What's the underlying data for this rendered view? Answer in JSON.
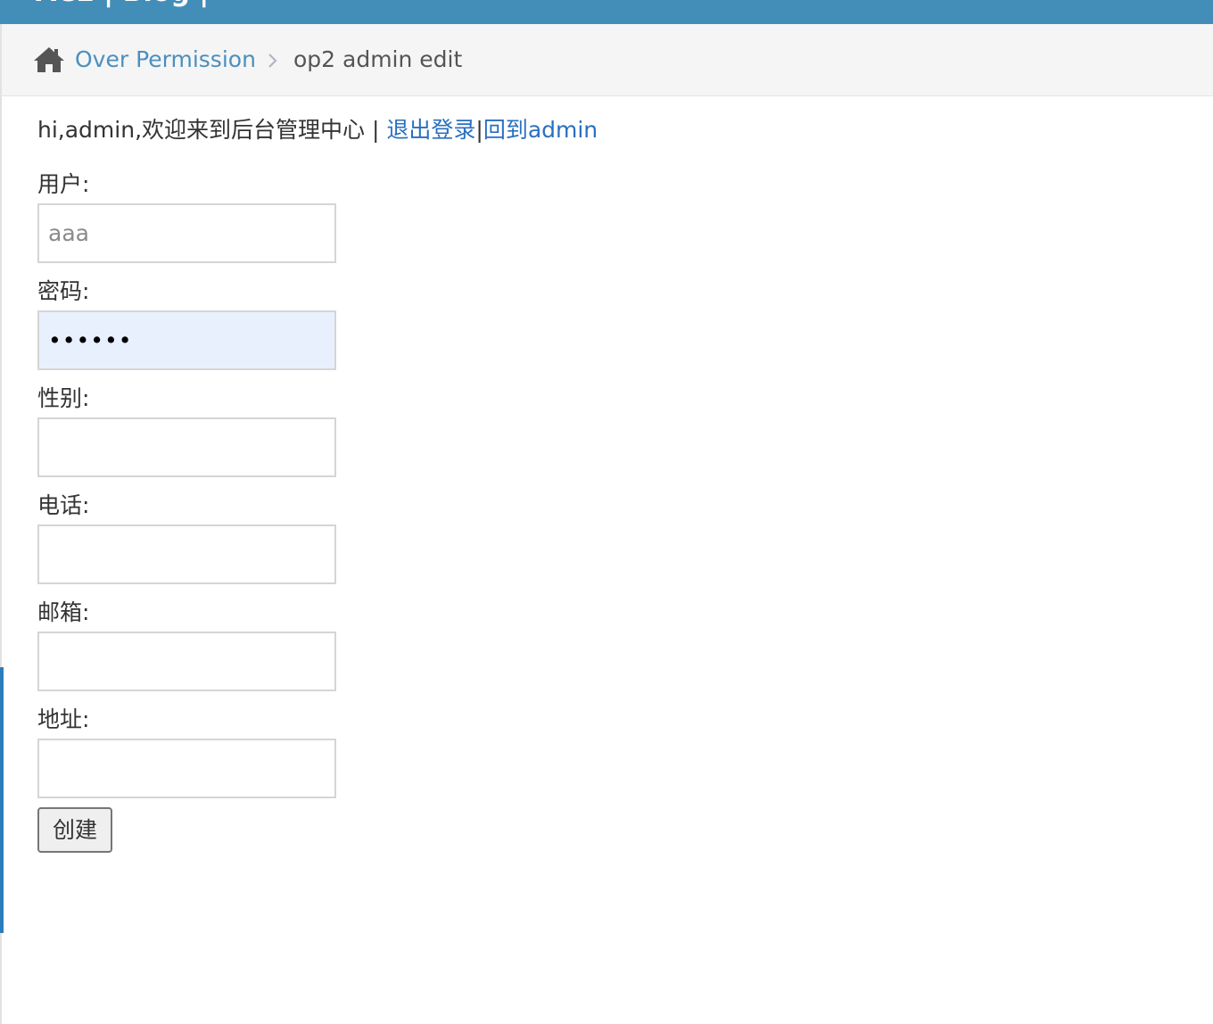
{
  "topbar": {
    "cropped_text": "ACE | Blog |"
  },
  "breadcrumb": {
    "home_icon": "home-icon",
    "link_label": "Over Permission",
    "separator_icon": "chevron-right-icon",
    "active_label": "op2 admin edit"
  },
  "greeting": {
    "text": "hi,admin,欢迎来到后台管理中心",
    "divider": " | ",
    "logout_label": "退出登录",
    "pipe": "|",
    "back_label": "回到admin"
  },
  "form": {
    "username": {
      "label": "用户:",
      "placeholder": "aaa",
      "value": ""
    },
    "password": {
      "label": "密码:",
      "value": "••••••"
    },
    "gender": {
      "label": "性别:",
      "value": ""
    },
    "phone": {
      "label": "电话:",
      "value": ""
    },
    "email": {
      "label": "邮箱:",
      "value": ""
    },
    "address": {
      "label": "地址:",
      "value": ""
    },
    "submit_label": "创建"
  },
  "colors": {
    "topbar": "#438eb9",
    "breadcrumb_bg": "#f5f5f5",
    "link": "#4c8fbd",
    "autofill_bg": "#e8f0fe",
    "sidebar_accent": "#2b7dbc"
  }
}
